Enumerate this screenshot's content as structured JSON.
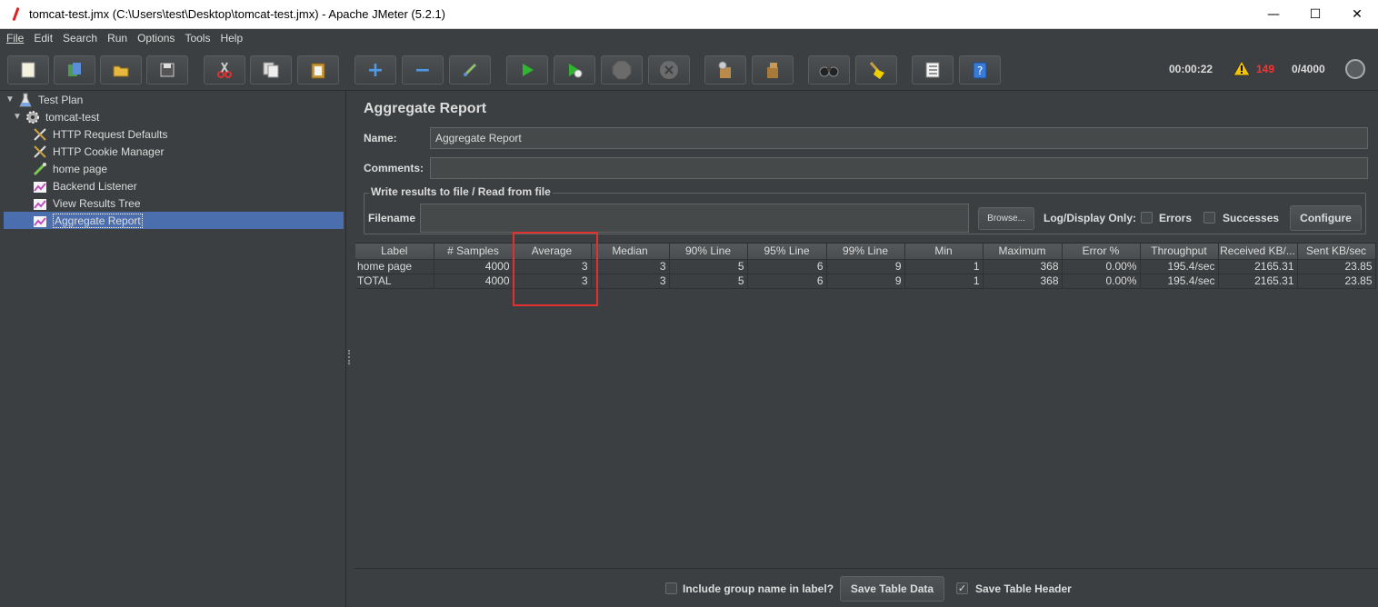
{
  "window": {
    "title": "tomcat-test.jmx (C:\\Users\\test\\Desktop\\tomcat-test.jmx) - Apache JMeter (5.2.1)",
    "minimize": "—",
    "maximize": "☐",
    "close": "✕"
  },
  "menu": [
    "File",
    "Edit",
    "Search",
    "Run",
    "Options",
    "Tools",
    "Help"
  ],
  "status": {
    "elapsed": "00:00:22",
    "warnings": "149",
    "threads": "0/4000"
  },
  "tree": {
    "items": [
      {
        "label": "Test Plan",
        "icon": "test-plan-icon"
      },
      {
        "label": "tomcat-test",
        "icon": "thread-group-icon"
      },
      {
        "label": "HTTP Request Defaults",
        "icon": "config-wrench-icon"
      },
      {
        "label": "HTTP Cookie Manager",
        "icon": "config-wrench-icon"
      },
      {
        "label": "home page",
        "icon": "sampler-pipette-icon"
      },
      {
        "label": "Backend Listener",
        "icon": "listener-chart-icon"
      },
      {
        "label": "View Results Tree",
        "icon": "listener-chart-icon"
      },
      {
        "label": "Aggregate Report",
        "icon": "listener-chart-icon"
      }
    ]
  },
  "panel": {
    "title": "Aggregate Report",
    "name_label": "Name:",
    "name_value": "Aggregate Report",
    "comments_label": "Comments:",
    "comments_value": "",
    "group_title": "Write results to file / Read from file",
    "filename_label": "Filename",
    "filename_value": "",
    "browse": "Browse...",
    "log_display": "Log/Display Only:",
    "errors": "Errors",
    "successes": "Successes",
    "configure": "Configure"
  },
  "table": {
    "headers": [
      "Label",
      "# Samples",
      "Average",
      "Median",
      "90% Line",
      "95% Line",
      "99% Line",
      "Min",
      "Maximum",
      "Error %",
      "Throughput",
      "Received KB/...",
      "Sent KB/sec"
    ],
    "rows": [
      [
        "home page",
        "4000",
        "3",
        "3",
        "5",
        "6",
        "9",
        "1",
        "368",
        "0.00%",
        "195.4/sec",
        "2165.31",
        "23.85"
      ],
      [
        "TOTAL",
        "4000",
        "3",
        "3",
        "5",
        "6",
        "9",
        "1",
        "368",
        "0.00%",
        "195.4/sec",
        "2165.31",
        "23.85"
      ]
    ]
  },
  "bottom": {
    "include_group": "Include group name in label?",
    "save_table_data": "Save Table Data",
    "save_table_header": "Save Table Header",
    "save_table_header_check": "✓"
  },
  "colors": {
    "background": "#3c3f41",
    "selection": "#4b6eaf",
    "highlight_box": "#e03030",
    "warning_count": "#ff3030"
  }
}
